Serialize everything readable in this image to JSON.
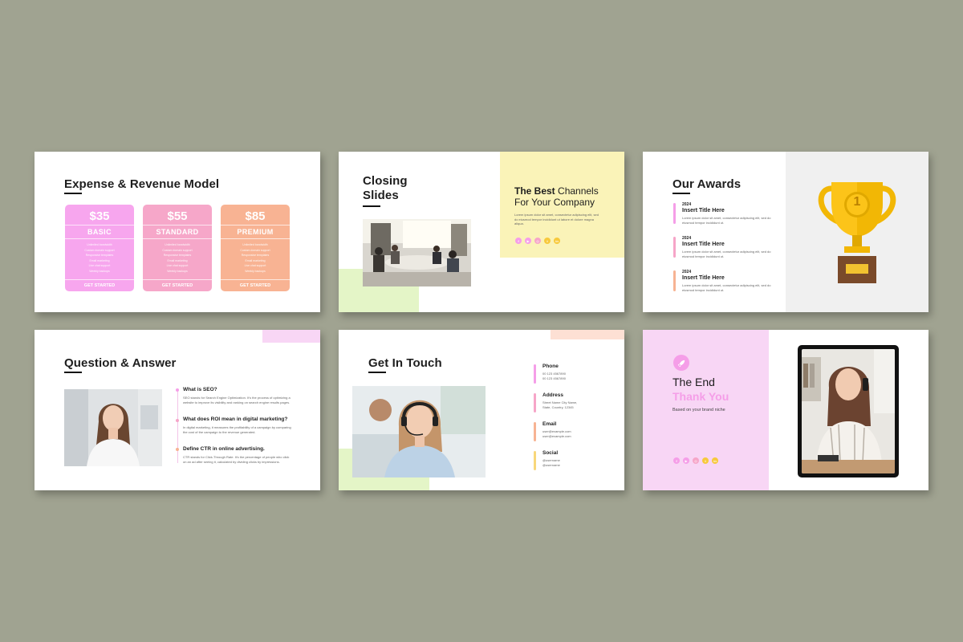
{
  "colors": {
    "pink": "#f59ee8",
    "rose": "#f6a5c8",
    "peach": "#f7b393",
    "yellow": "#faf3b8",
    "green": "#e4f5c7",
    "lavender": "#f8d6f5",
    "bg": "#a0a391"
  },
  "slide1": {
    "title": "Expense & Revenue Model",
    "cards": [
      {
        "price": "$35",
        "plan": "BASIC",
        "cta": "GET STARTED"
      },
      {
        "price": "$55",
        "plan": "STANDARD",
        "cta": "GET STARTED"
      },
      {
        "price": "$85",
        "plan": "PREMIUM",
        "cta": "GET STARTED"
      }
    ],
    "features": [
      "Unlimited bandwidth",
      "Custom domain support",
      "Responsive templates",
      "Email marketing",
      "Live chat support",
      "Weekly backups"
    ]
  },
  "slide2": {
    "title_line1": "Closing",
    "title_line2": "Slides",
    "heading_bold": "The Best",
    "heading_rest": " Channels",
    "heading_line2": "For Your Company",
    "body": "Lorem ipsum dolor sit amet, consectetur adipiscing elit, sed do eiusmod tempor incididunt ut labore et dolore magna aliqua.",
    "social_icons": [
      "facebook-icon",
      "youtube-icon",
      "instagram-icon",
      "twitter-icon",
      "linkedin-icon"
    ]
  },
  "slide3": {
    "title": "Our Awards",
    "awards": [
      {
        "year": "2024",
        "title": "Insert Title Here",
        "text": "Lorem ipsum dolor sit amet, consectetur adipiscing elit, sed do eiusmod tempor incididunt ut."
      },
      {
        "year": "2024",
        "title": "Insert Title Here",
        "text": "Lorem ipsum dolor sit amet, consectetur adipiscing elit, sed do eiusmod tempor incididunt ut."
      },
      {
        "year": "2024",
        "title": "Insert Title Here",
        "text": "Lorem ipsum dolor sit amet, consectetur adipiscing elit, sed do eiusmod tempor incididunt ut."
      }
    ],
    "trophy_number": "1"
  },
  "slide4": {
    "title": "Question & Answer",
    "qa": [
      {
        "q": "What is SEO?",
        "a": "SEO stands for Search Engine Optimization. It's the process of optimizing a website to improve its visibility and ranking on search engine results pages."
      },
      {
        "q": "What does ROI mean in digital marketing?",
        "a": "In digital marketing, it measures the profitability of a campaign by comparing the cost of the campaign to the revenue generated."
      },
      {
        "q": "Define CTR in online advertising.",
        "a": "CTR stands for Click-Through Rate. It's the percentage of people who click on an ad after seeing it, calculated by dividing clicks by impressions."
      }
    ]
  },
  "slide5": {
    "title": "Get In Touch",
    "contacts": [
      {
        "label": "Phone",
        "lines": [
          "00 123 4567890",
          "00 123 4567890"
        ]
      },
      {
        "label": "Address",
        "lines": [
          "Street Name City Name,",
          "State, Country, 12345"
        ]
      },
      {
        "label": "Email",
        "lines": [
          "user@example.com",
          "user@example.com"
        ]
      },
      {
        "label": "Social",
        "lines": [
          "@username",
          "@username"
        ]
      }
    ]
  },
  "slide6": {
    "line1": "The End",
    "line2": "Thank You",
    "sub": "Based on your brand niche",
    "social_icons": [
      "facebook-icon",
      "youtube-icon",
      "instagram-icon",
      "twitter-icon",
      "linkedin-icon"
    ]
  }
}
